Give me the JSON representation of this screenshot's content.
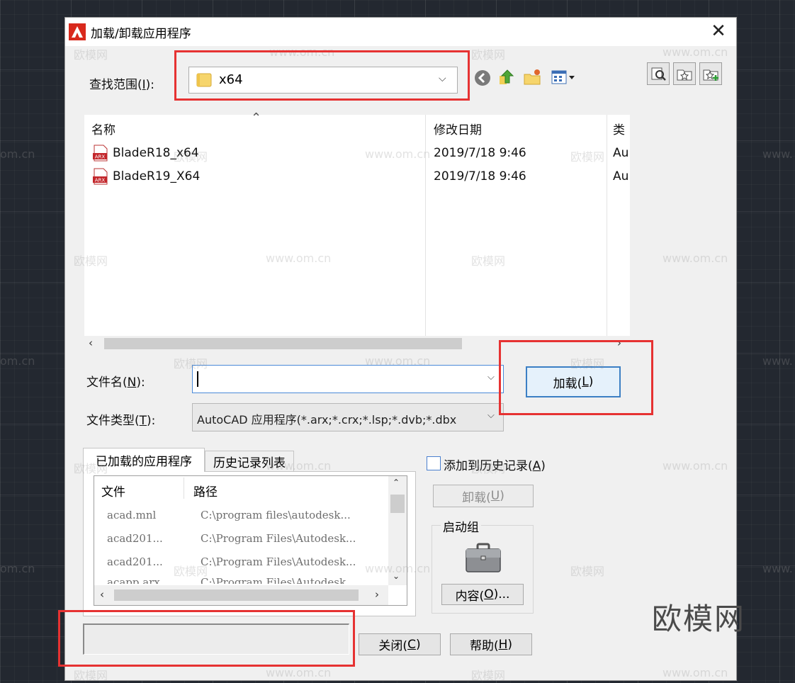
{
  "dialog": {
    "title": "加载/卸载应用程序",
    "close_glyph": "✕"
  },
  "look_in": {
    "label": "查找范围(",
    "label_key": "I",
    "label_end": "):",
    "value": "x64"
  },
  "file_list": {
    "sort_glyph": "⌃",
    "columns": [
      "名称",
      "修改日期",
      "类"
    ],
    "rows": [
      {
        "name": "BladeR18_x64",
        "date": "2019/7/18 9:46",
        "type": "Au"
      },
      {
        "name": "BladeR19_X64",
        "date": "2019/7/18 9:46",
        "type": "Au"
      }
    ],
    "icon_text": "ARX"
  },
  "filename": {
    "label": "文件名(",
    "label_key": "N",
    "label_end": "):",
    "value": ""
  },
  "filetype": {
    "label": "文件类型(",
    "label_key": "T",
    "label_end": "):",
    "value": "AutoCAD 应用程序(*.arx;*.crx;*.lsp;*.dvb;*.dbx"
  },
  "load_button": {
    "label": "加载(",
    "key": "L",
    "end": ")"
  },
  "tabs": {
    "loaded": "已加载的应用程序",
    "history": "历史记录列表"
  },
  "loaded_apps": {
    "columns": [
      "文件",
      "路径"
    ],
    "rows": [
      {
        "file": "acad.mnl",
        "path": "C:\\program files\\autodesk..."
      },
      {
        "file": "acad201...",
        "path": "C:\\Program Files\\Autodesk..."
      },
      {
        "file": "acad201...",
        "path": "C:\\Program Files\\Autodesk..."
      },
      {
        "file": "acapp.arx",
        "path": "C:\\Program Files\\Autodesk..."
      }
    ]
  },
  "history_checkbox": {
    "label": "添加到历史记录(",
    "key": "A",
    "end": ")",
    "checked": false
  },
  "unload_button": {
    "label": "卸载(",
    "key": "U",
    "end": ")"
  },
  "startup_suite": {
    "title": "启动组",
    "contents_label": "内容(",
    "contents_key": "O",
    "contents_end": ")..."
  },
  "status": {
    "value": ""
  },
  "close_button": {
    "label": "关闭(",
    "key": "C",
    "end": ")"
  },
  "help_button": {
    "label": "帮助(",
    "key": "H",
    "end": ")"
  },
  "watermark": {
    "big": "欧模网",
    "small": "欧模网",
    "url": "www.om.cn",
    "url_partial": "om.cn",
    "url_prefix": "www."
  },
  "colors": {
    "highlight": "#e63232",
    "accent": "#3c7fc4",
    "dialog_bg": "#f0f0f0",
    "desktop_bg": "#232830"
  }
}
